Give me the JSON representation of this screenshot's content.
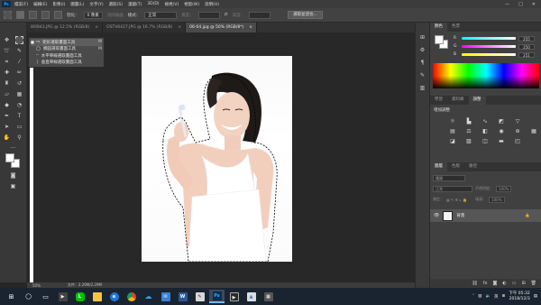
{
  "menubar": {
    "logo": "Ps",
    "items": [
      "檔案(F)",
      "編輯(E)",
      "影像(I)",
      "圖層(L)",
      "文字(Y)",
      "選取(S)",
      "濾鏡(T)",
      "3D(D)",
      "檢視(V)",
      "視窗(W)",
      "說明(H)"
    ],
    "window_controls": [
      "—",
      "□",
      "✕"
    ]
  },
  "options": {
    "feather_label": "羽化：",
    "feather_value": "0 像素",
    "antialias_label": "消除鋸齒",
    "style_label": "樣式：",
    "style_value": "正常",
    "width_label": "寬度：",
    "height_label": "高度：",
    "select_mask_button": "選取並遮住..."
  },
  "tabs": [
    {
      "label": "8I0843.JPG @ 12.5% (RGB/8)",
      "close": "×",
      "active": false
    },
    {
      "label": "OSTV6427.JPG @ 16.7% (RGB/8)",
      "close": "×",
      "active": false
    },
    {
      "label": "06-04.jpg @ 50% (RGB/8*)",
      "close": "×",
      "active": true
    }
  ],
  "flyout": {
    "items": [
      {
        "label": "矩形選取畫面工具",
        "key": "M",
        "selected": true
      },
      {
        "label": "橢圓選取畫面工具",
        "key": "M",
        "selected": false
      },
      {
        "label": "水平單線選取畫面工具",
        "key": "",
        "selected": false
      },
      {
        "label": "垂直單線選取畫面工具",
        "key": "",
        "selected": false
      }
    ]
  },
  "status": {
    "zoom": "50%",
    "doc_size": "文件：2.29M/2.29M"
  },
  "color_panel": {
    "tabs": [
      "顏色",
      "色票"
    ],
    "sliders": [
      {
        "label": "R",
        "value": "255",
        "color": "#ff3c3c"
      },
      {
        "label": "G",
        "value": "250",
        "color": "#3cff3c"
      },
      {
        "label": "B",
        "value": "251",
        "color": "#ff3cff"
      }
    ]
  },
  "adjust_panel": {
    "tabs": [
      "學習",
      "資料庫",
      "調整"
    ],
    "title": "增加調整"
  },
  "layers_panel": {
    "tabs": [
      "圖層",
      "色版",
      "路徑"
    ],
    "kind_label": "種類",
    "blend_mode": "正常",
    "opacity_label": "不透明度：",
    "opacity_value": "100%",
    "lock_label": "鎖定：",
    "fill_label": "填滿：",
    "fill_value": "100%",
    "layer_name": "背景"
  },
  "taskbar": {
    "lang_label": "英",
    "time": "下午 05:32",
    "date": "2018/12/3"
  },
  "colors": {
    "accent": "#31a8ff",
    "panel_bg": "#404040",
    "canvas_bg": "#282828"
  }
}
